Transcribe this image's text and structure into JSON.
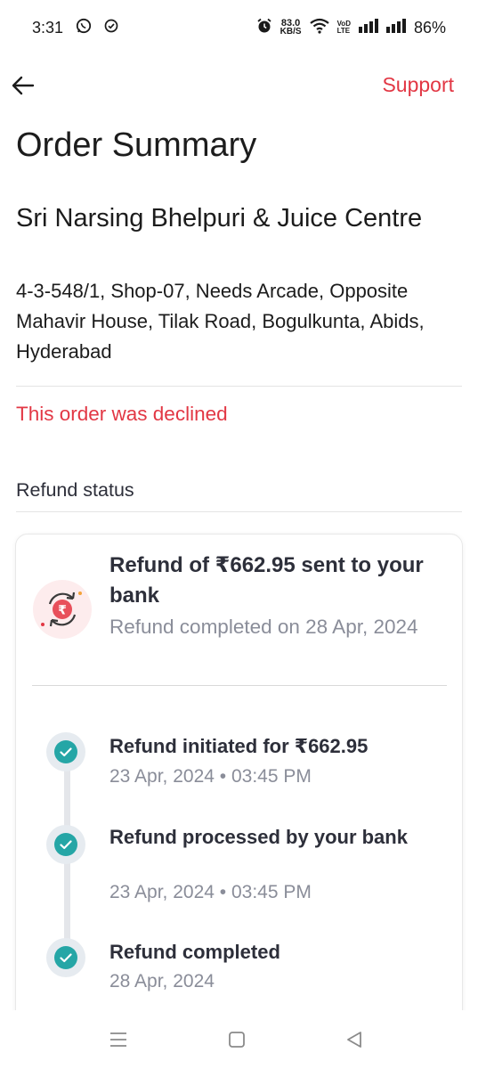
{
  "status_bar": {
    "time": "3:31",
    "speed_value": "83.0",
    "speed_unit": "KB/S",
    "volte_top": "VoD",
    "volte_bottom": "LTE",
    "battery": "86%"
  },
  "header": {
    "back_icon": "arrow-left-icon",
    "support_label": "Support"
  },
  "page": {
    "title": "Order Summary",
    "restaurant_name": "Sri Narsing Bhelpuri & Juice Centre",
    "restaurant_address": "4-3-548/1, Shop-07, Needs Arcade, Opposite Mahavir House, Tilak Road, Bogulkunta, Abids, Hyderabad",
    "order_status": "This order was declined",
    "refund_heading": "Refund status"
  },
  "refund_card": {
    "summary_title": "Refund of ₹662.95 sent to your bank",
    "summary_subtitle": "Refund completed on 28 Apr, 2024",
    "steps": [
      {
        "title": "Refund initiated for ₹662.95",
        "date": "23 Apr, 2024 • 03:45 PM"
      },
      {
        "title": "Refund processed by your bank",
        "date": "23 Apr, 2024 • 03:45 PM"
      },
      {
        "title": "Refund completed",
        "date": "28 Apr, 2024"
      }
    ]
  },
  "colors": {
    "accent": "#e23744",
    "check": "#25a6a6",
    "text_dark": "#2d2f3a",
    "text_muted": "#8a8d99"
  }
}
